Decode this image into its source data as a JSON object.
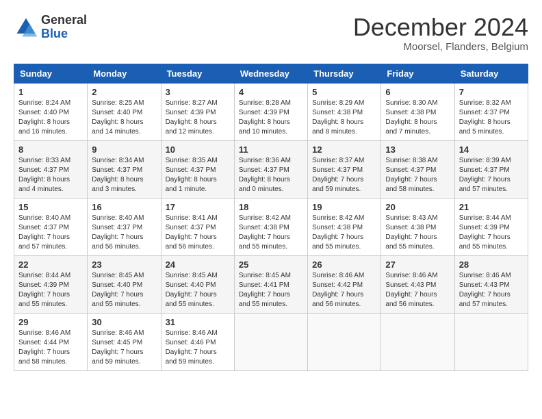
{
  "header": {
    "logo_line1": "General",
    "logo_line2": "Blue",
    "month_title": "December 2024",
    "subtitle": "Moorsel, Flanders, Belgium"
  },
  "weekdays": [
    "Sunday",
    "Monday",
    "Tuesday",
    "Wednesday",
    "Thursday",
    "Friday",
    "Saturday"
  ],
  "weeks": [
    [
      {
        "day": "1",
        "sunrise": "Sunrise: 8:24 AM",
        "sunset": "Sunset: 4:40 PM",
        "daylight": "Daylight: 8 hours and 16 minutes."
      },
      {
        "day": "2",
        "sunrise": "Sunrise: 8:25 AM",
        "sunset": "Sunset: 4:40 PM",
        "daylight": "Daylight: 8 hours and 14 minutes."
      },
      {
        "day": "3",
        "sunrise": "Sunrise: 8:27 AM",
        "sunset": "Sunset: 4:39 PM",
        "daylight": "Daylight: 8 hours and 12 minutes."
      },
      {
        "day": "4",
        "sunrise": "Sunrise: 8:28 AM",
        "sunset": "Sunset: 4:39 PM",
        "daylight": "Daylight: 8 hours and 10 minutes."
      },
      {
        "day": "5",
        "sunrise": "Sunrise: 8:29 AM",
        "sunset": "Sunset: 4:38 PM",
        "daylight": "Daylight: 8 hours and 8 minutes."
      },
      {
        "day": "6",
        "sunrise": "Sunrise: 8:30 AM",
        "sunset": "Sunset: 4:38 PM",
        "daylight": "Daylight: 8 hours and 7 minutes."
      },
      {
        "day": "7",
        "sunrise": "Sunrise: 8:32 AM",
        "sunset": "Sunset: 4:37 PM",
        "daylight": "Daylight: 8 hours and 5 minutes."
      }
    ],
    [
      {
        "day": "8",
        "sunrise": "Sunrise: 8:33 AM",
        "sunset": "Sunset: 4:37 PM",
        "daylight": "Daylight: 8 hours and 4 minutes."
      },
      {
        "day": "9",
        "sunrise": "Sunrise: 8:34 AM",
        "sunset": "Sunset: 4:37 PM",
        "daylight": "Daylight: 8 hours and 3 minutes."
      },
      {
        "day": "10",
        "sunrise": "Sunrise: 8:35 AM",
        "sunset": "Sunset: 4:37 PM",
        "daylight": "Daylight: 8 hours and 1 minute."
      },
      {
        "day": "11",
        "sunrise": "Sunrise: 8:36 AM",
        "sunset": "Sunset: 4:37 PM",
        "daylight": "Daylight: 8 hours and 0 minutes."
      },
      {
        "day": "12",
        "sunrise": "Sunrise: 8:37 AM",
        "sunset": "Sunset: 4:37 PM",
        "daylight": "Daylight: 7 hours and 59 minutes."
      },
      {
        "day": "13",
        "sunrise": "Sunrise: 8:38 AM",
        "sunset": "Sunset: 4:37 PM",
        "daylight": "Daylight: 7 hours and 58 minutes."
      },
      {
        "day": "14",
        "sunrise": "Sunrise: 8:39 AM",
        "sunset": "Sunset: 4:37 PM",
        "daylight": "Daylight: 7 hours and 57 minutes."
      }
    ],
    [
      {
        "day": "15",
        "sunrise": "Sunrise: 8:40 AM",
        "sunset": "Sunset: 4:37 PM",
        "daylight": "Daylight: 7 hours and 57 minutes."
      },
      {
        "day": "16",
        "sunrise": "Sunrise: 8:40 AM",
        "sunset": "Sunset: 4:37 PM",
        "daylight": "Daylight: 7 hours and 56 minutes."
      },
      {
        "day": "17",
        "sunrise": "Sunrise: 8:41 AM",
        "sunset": "Sunset: 4:37 PM",
        "daylight": "Daylight: 7 hours and 56 minutes."
      },
      {
        "day": "18",
        "sunrise": "Sunrise: 8:42 AM",
        "sunset": "Sunset: 4:38 PM",
        "daylight": "Daylight: 7 hours and 55 minutes."
      },
      {
        "day": "19",
        "sunrise": "Sunrise: 8:42 AM",
        "sunset": "Sunset: 4:38 PM",
        "daylight": "Daylight: 7 hours and 55 minutes."
      },
      {
        "day": "20",
        "sunrise": "Sunrise: 8:43 AM",
        "sunset": "Sunset: 4:38 PM",
        "daylight": "Daylight: 7 hours and 55 minutes."
      },
      {
        "day": "21",
        "sunrise": "Sunrise: 8:44 AM",
        "sunset": "Sunset: 4:39 PM",
        "daylight": "Daylight: 7 hours and 55 minutes."
      }
    ],
    [
      {
        "day": "22",
        "sunrise": "Sunrise: 8:44 AM",
        "sunset": "Sunset: 4:39 PM",
        "daylight": "Daylight: 7 hours and 55 minutes."
      },
      {
        "day": "23",
        "sunrise": "Sunrise: 8:45 AM",
        "sunset": "Sunset: 4:40 PM",
        "daylight": "Daylight: 7 hours and 55 minutes."
      },
      {
        "day": "24",
        "sunrise": "Sunrise: 8:45 AM",
        "sunset": "Sunset: 4:40 PM",
        "daylight": "Daylight: 7 hours and 55 minutes."
      },
      {
        "day": "25",
        "sunrise": "Sunrise: 8:45 AM",
        "sunset": "Sunset: 4:41 PM",
        "daylight": "Daylight: 7 hours and 55 minutes."
      },
      {
        "day": "26",
        "sunrise": "Sunrise: 8:46 AM",
        "sunset": "Sunset: 4:42 PM",
        "daylight": "Daylight: 7 hours and 56 minutes."
      },
      {
        "day": "27",
        "sunrise": "Sunrise: 8:46 AM",
        "sunset": "Sunset: 4:43 PM",
        "daylight": "Daylight: 7 hours and 56 minutes."
      },
      {
        "day": "28",
        "sunrise": "Sunrise: 8:46 AM",
        "sunset": "Sunset: 4:43 PM",
        "daylight": "Daylight: 7 hours and 57 minutes."
      }
    ],
    [
      {
        "day": "29",
        "sunrise": "Sunrise: 8:46 AM",
        "sunset": "Sunset: 4:44 PM",
        "daylight": "Daylight: 7 hours and 58 minutes."
      },
      {
        "day": "30",
        "sunrise": "Sunrise: 8:46 AM",
        "sunset": "Sunset: 4:45 PM",
        "daylight": "Daylight: 7 hours and 59 minutes."
      },
      {
        "day": "31",
        "sunrise": "Sunrise: 8:46 AM",
        "sunset": "Sunset: 4:46 PM",
        "daylight": "Daylight: 7 hours and 59 minutes."
      },
      null,
      null,
      null,
      null
    ]
  ]
}
